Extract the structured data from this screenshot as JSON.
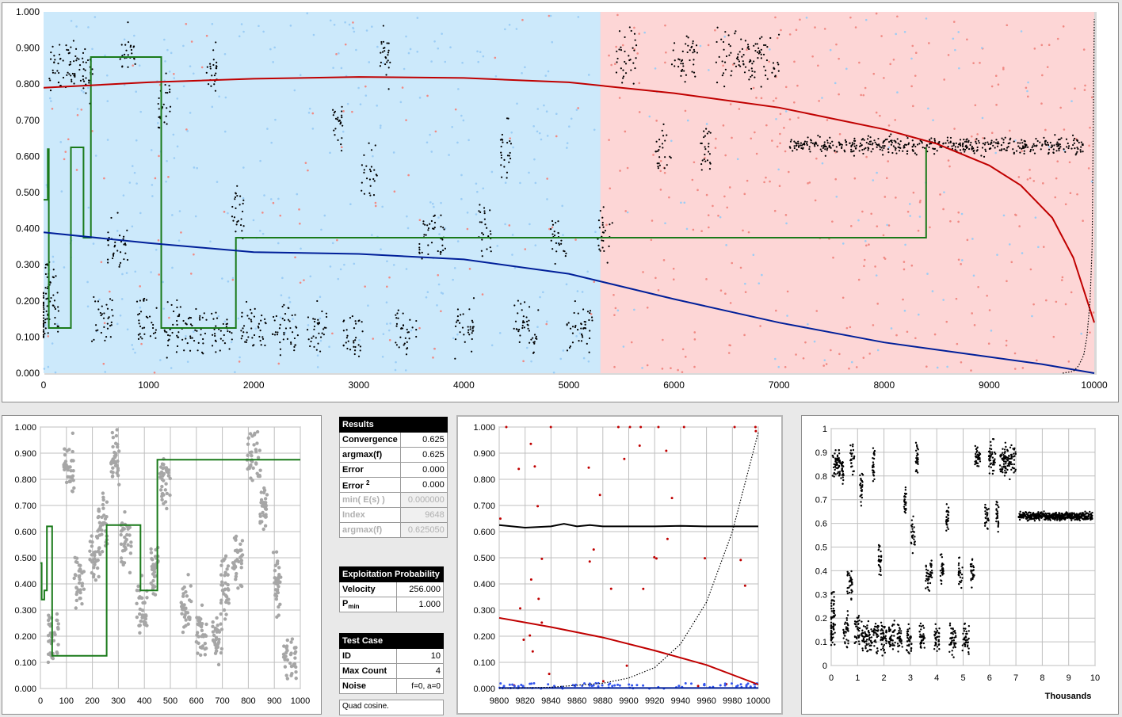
{
  "chart_data": [
    {
      "type": "scatter",
      "xlim": [
        0,
        10000
      ],
      "ylim": [
        0,
        1
      ],
      "x_ticks": [
        "0",
        "1000",
        "2000",
        "3000",
        "4000",
        "5000",
        "6000",
        "7000",
        "8000",
        "9000",
        "10000"
      ],
      "y_ticks": [
        "0.000",
        "0.100",
        "0.200",
        "0.300",
        "0.400",
        "0.500",
        "0.600",
        "0.700",
        "0.800",
        "0.900",
        "1.000"
      ],
      "background_split_x": 5300,
      "colors": {
        "blue_bg": "#cce9fb",
        "red_bg": "#fdd6d6",
        "dots": "#000000",
        "step": "#1a7a1a",
        "red_curve": "#c00000",
        "blue_curve": "#001f99",
        "blue_pts": "#9ccdf5",
        "red_pts": "#f08a84"
      },
      "series": [
        {
          "kind": "step",
          "x": [
            0,
            40,
            40,
            50,
            50,
            260,
            260,
            380,
            380,
            450,
            450,
            1120,
            1120,
            1830,
            1830,
            8400,
            8400
          ],
          "y": [
            0.48,
            0.48,
            0.62,
            0.62,
            0.125,
            0.125,
            0.625,
            0.625,
            0.375,
            0.375,
            0.875,
            0.875,
            0.125,
            0.125,
            0.375,
            0.375,
            0.625
          ]
        },
        {
          "kind": "curve",
          "x": [
            0,
            1000,
            2000,
            3000,
            4000,
            5000,
            6000,
            7000,
            8000,
            8500,
            9000,
            9300,
            9600,
            9800,
            10000
          ],
          "y": [
            0.79,
            0.805,
            0.815,
            0.82,
            0.817,
            0.805,
            0.775,
            0.735,
            0.675,
            0.635,
            0.575,
            0.52,
            0.43,
            0.32,
            0.14
          ]
        },
        {
          "kind": "curve",
          "x": [
            0,
            1000,
            2000,
            3000,
            4000,
            5000,
            6000,
            7000,
            8000,
            9000,
            9500,
            10000
          ],
          "y": [
            0.39,
            0.36,
            0.335,
            0.33,
            0.315,
            0.275,
            0.205,
            0.14,
            0.085,
            0.045,
            0.025,
            0.0
          ]
        },
        {
          "kind": "dotted",
          "x": [
            9700,
            9800,
            9850,
            9900,
            9930,
            9960,
            9980,
            10000
          ],
          "y": [
            0.0,
            0.005,
            0.02,
            0.05,
            0.1,
            0.2,
            0.35,
            0.98
          ]
        }
      ]
    },
    {
      "type": "scatter",
      "xlim": [
        0,
        1000
      ],
      "ylim": [
        0,
        1
      ],
      "x_ticks": [
        "0",
        "100",
        "200",
        "300",
        "400",
        "500",
        "600",
        "700",
        "800",
        "900",
        "1000"
      ],
      "y_ticks": [
        "0.000",
        "0.100",
        "0.200",
        "0.300",
        "0.400",
        "0.500",
        "0.600",
        "0.700",
        "0.800",
        "0.900",
        "1.000"
      ],
      "series": [
        {
          "kind": "step",
          "x": [
            0,
            5,
            5,
            15,
            15,
            25,
            25,
            45,
            45,
            255,
            255,
            385,
            385,
            450,
            450,
            1000
          ],
          "y": [
            0.48,
            0.48,
            0.34,
            0.34,
            0.375,
            0.375,
            0.62,
            0.62,
            0.125,
            0.125,
            0.625,
            0.625,
            0.375,
            0.375,
            0.875,
            0.875
          ]
        }
      ]
    },
    {
      "type": "scatter",
      "xlim": [
        9800,
        10000
      ],
      "ylim": [
        0,
        1
      ],
      "x_ticks": [
        "9800",
        "9820",
        "9840",
        "9860",
        "9880",
        "9900",
        "9920",
        "9940",
        "9960",
        "9980",
        "10000"
      ],
      "y_ticks": [
        "0.000",
        "0.100",
        "0.200",
        "0.300",
        "0.400",
        "0.500",
        "0.600",
        "0.700",
        "0.800",
        "0.900",
        "1.000"
      ],
      "series": [
        {
          "kind": "line",
          "x": [
            9800,
            9820,
            9840,
            9850,
            9860,
            9870,
            9880,
            9900,
            9920,
            9940,
            9960,
            9980,
            10000
          ],
          "y": [
            0.625,
            0.615,
            0.62,
            0.63,
            0.62,
            0.625,
            0.62,
            0.62,
            0.62,
            0.622,
            0.62,
            0.62,
            0.62
          ]
        },
        {
          "kind": "curve",
          "x": [
            9800,
            9840,
            9880,
            9920,
            9960,
            10000
          ],
          "y": [
            0.27,
            0.235,
            0.195,
            0.145,
            0.09,
            0.015
          ]
        },
        {
          "kind": "dotted",
          "x": [
            9800,
            9840,
            9880,
            9900,
            9920,
            9940,
            9960,
            9980,
            10000
          ],
          "y": [
            0.0,
            0.005,
            0.02,
            0.04,
            0.08,
            0.17,
            0.33,
            0.6,
            0.98
          ]
        }
      ]
    },
    {
      "type": "scatter",
      "xlim": [
        0,
        10
      ],
      "ylim": [
        0,
        1
      ],
      "xlabel": "Thousands",
      "x_ticks": [
        "0",
        "1",
        "2",
        "3",
        "4",
        "5",
        "6",
        "7",
        "8",
        "9",
        "10"
      ],
      "y_ticks": [
        "0",
        "0.1",
        "0.2",
        "0.3",
        "0.4",
        "0.5",
        "0.6",
        "0.7",
        "0.8",
        "0.9",
        "1"
      ]
    }
  ],
  "results": {
    "title": "Results",
    "rows": [
      {
        "label": "Convergence",
        "value": "0.625"
      },
      {
        "label": "argmax(f)",
        "value": "0.625"
      },
      {
        "label": "Error",
        "value": "0.000"
      },
      {
        "label": "Error",
        "sup": "2",
        "value": "0.000"
      }
    ],
    "dim_rows": [
      {
        "label": "min( E(s) )",
        "value": "0.000000"
      },
      {
        "label": "Index",
        "value": "9648"
      },
      {
        "label": "argmax(f)",
        "value": "0.625050"
      }
    ]
  },
  "exploit": {
    "title": "Exploitation Probability",
    "velocity_label": "Velocity",
    "velocity": "256.000",
    "pmin_label": "P",
    "pmin_sub": "min",
    "pmin": "1.000"
  },
  "test_case": {
    "title": "Test Case",
    "id_label": "ID",
    "id": "10",
    "max_label": "Max Count",
    "max": "4",
    "noise_label": "Noise",
    "noise": "f=0, a=0",
    "note": "Quad cosine."
  }
}
